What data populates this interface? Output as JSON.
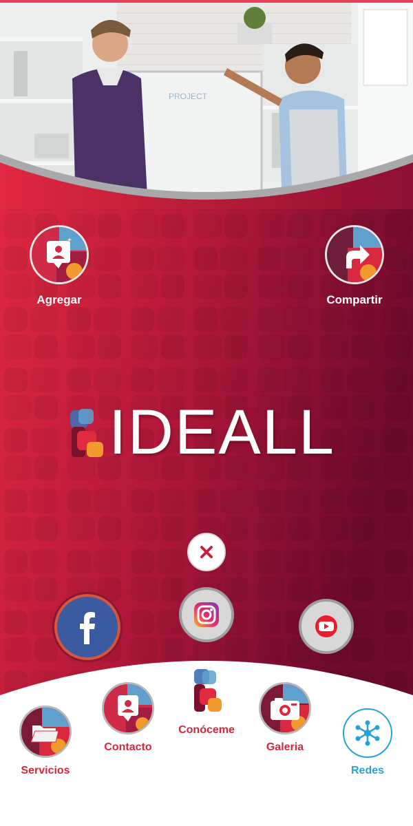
{
  "brand": {
    "name": "IDEALL",
    "colors": {
      "red": "#e02a40",
      "dark_red": "#7a0c2e",
      "blue": "#27a2d6",
      "orange": "#f29a2e"
    }
  },
  "top_actions": {
    "add": {
      "label": "Agregar",
      "icon": "add-contact-icon"
    },
    "share": {
      "label": "Compartir",
      "icon": "share-icon"
    }
  },
  "social": {
    "close_icon": "close-icon",
    "facebook_icon": "facebook-icon",
    "instagram_icon": "instagram-icon",
    "youtube_icon": "youtube-icon"
  },
  "bottom_nav": {
    "items": [
      {
        "label": "Servicios",
        "icon": "folder-icon"
      },
      {
        "label": "Contacto",
        "icon": "contact-icon"
      },
      {
        "label": "Conóceme",
        "icon": "brand-logo-icon"
      },
      {
        "label": "Galeria",
        "icon": "camera-icon"
      },
      {
        "label": "Redes",
        "icon": "network-icon"
      }
    ]
  }
}
